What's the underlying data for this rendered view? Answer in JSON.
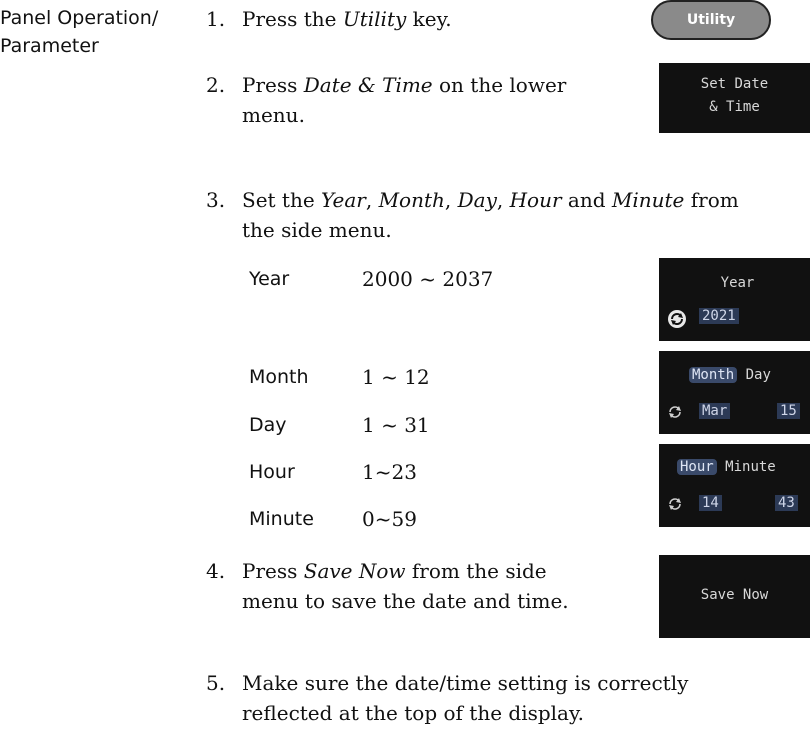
{
  "side_label": {
    "line1": "Panel Operation/",
    "line2": "Parameter"
  },
  "steps": [
    {
      "num": "1.",
      "pre": "Press the ",
      "em": "Utility",
      "post": " key."
    },
    {
      "num": "2.",
      "pre": "Press ",
      "em": "Date & Time",
      "post": " on the lower",
      "line2": "menu."
    },
    {
      "num": "3.",
      "line1_pre": "Set the ",
      "em_year": "Year",
      "sep1": ", ",
      "em_month": "Month",
      "sep2": ", ",
      "em_day": "Day",
      "sep3": ", ",
      "em_hour": "Hour",
      "and": " and ",
      "em_minute": "Minute",
      "line1_post": " from",
      "line2": "the side menu."
    },
    {
      "num": "4.",
      "pre": "Press ",
      "em": "Save Now",
      "post": " from the side",
      "line2": "menu to save the date and time."
    },
    {
      "num": "5.",
      "line1": "Make sure the date/time setting is correctly",
      "line2": "reflected at the top of the display."
    }
  ],
  "params": [
    {
      "name": "Year",
      "range": "2000 ~ 2037"
    },
    {
      "name": "Month",
      "range": "1 ~ 12"
    },
    {
      "name": "Day",
      "range": "1 ~ 31"
    },
    {
      "name": "Hour",
      "range": "1~23"
    },
    {
      "name": "Minute",
      "range": "0~59"
    }
  ],
  "ui": {
    "utility_key": "Utility",
    "datetime_menu": {
      "line1": "Set Date",
      "line2": "& Time"
    },
    "year_menu": {
      "label": "Year",
      "value": "2021"
    },
    "monthday_menu": {
      "month_label": "Month",
      "day_label": "Day",
      "month_value": "Mar",
      "day_value": "15"
    },
    "hourminute_menu": {
      "hour_label": "Hour",
      "minute_label": "Minute",
      "hour_value": "14",
      "minute_value": "43"
    },
    "save_menu": "Save Now"
  }
}
